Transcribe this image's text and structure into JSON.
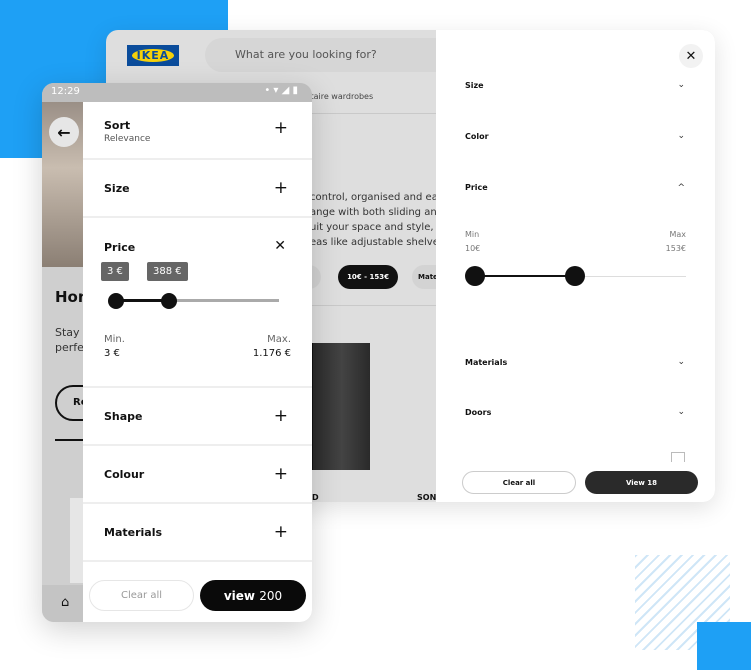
{
  "colors": {
    "accent_blue": "#1ea0f5",
    "dark": "#111111"
  },
  "desktop": {
    "logo": "IKEA",
    "search_placeholder": "What are you looking for?",
    "breadcrumb": "litaire wardrobes",
    "description": [
      "control, organised and easy t",
      "ange with both sliding and",
      "uit your space and style, a ch",
      "eas like adjustable shelves."
    ],
    "chips": [
      "or",
      "10€ - 153€",
      "Mate"
    ],
    "product_labels": [
      "D",
      "SONG"
    ],
    "filter_panel": {
      "close_icon": "close-icon",
      "sections": [
        {
          "label": "Size",
          "state": "collapsed"
        },
        {
          "label": "Color",
          "state": "collapsed"
        },
        {
          "label": "Price",
          "state": "expanded"
        },
        {
          "label": "Materials",
          "state": "collapsed"
        },
        {
          "label": "Doors",
          "state": "collapsed"
        }
      ],
      "price": {
        "min_label": "Min",
        "max_label": "Max",
        "min_value": "10€",
        "max_value": "153€",
        "slider_low": 0,
        "slider_high": 0.45
      },
      "clear_label": "Clear all",
      "view_label": "View 18"
    }
  },
  "phone": {
    "time": "12:29",
    "page_title": "Hon",
    "page_text": [
      "Stay c",
      "perfe"
    ],
    "page_button": "Re",
    "filters": {
      "sort": {
        "label": "Sort",
        "value": "Relevance"
      },
      "size": {
        "label": "Size"
      },
      "price": {
        "label": "Price",
        "tip_low": "3 €",
        "tip_high": "388 €",
        "min_label": "Min.",
        "min_value": "3 €",
        "max_label": "Max.",
        "max_value": "1.176 €",
        "slider_low": 0,
        "slider_high": 0.32
      },
      "shape": {
        "label": "Shape"
      },
      "colour": {
        "label": "Colour"
      },
      "materials": {
        "label": "Materials"
      }
    },
    "clear_label": "Clear all",
    "view_label_bold": "view",
    "view_count": "200"
  }
}
